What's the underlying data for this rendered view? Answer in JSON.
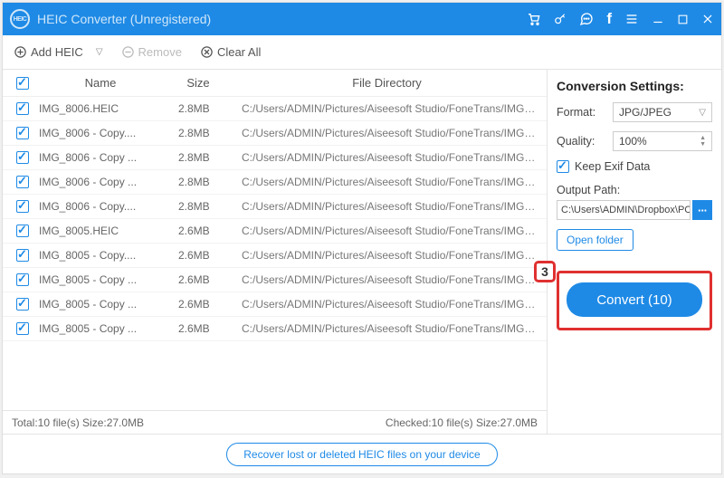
{
  "window": {
    "title": "HEIC Converter (Unregistered)"
  },
  "toolbar": {
    "addHeic": "Add HEIC",
    "remove": "Remove",
    "clearAll": "Clear All"
  },
  "table": {
    "headers": {
      "name": "Name",
      "size": "Size",
      "dir": "File Directory"
    },
    "rows": [
      {
        "name": "IMG_8006.HEIC",
        "size": "2.8MB",
        "dir": "C:/Users/ADMIN/Pictures/Aiseesoft Studio/FoneTrans/IMG_80..."
      },
      {
        "name": "IMG_8006 - Copy....",
        "size": "2.8MB",
        "dir": "C:/Users/ADMIN/Pictures/Aiseesoft Studio/FoneTrans/IMG_80..."
      },
      {
        "name": "IMG_8006 - Copy ...",
        "size": "2.8MB",
        "dir": "C:/Users/ADMIN/Pictures/Aiseesoft Studio/FoneTrans/IMG_80..."
      },
      {
        "name": "IMG_8006 - Copy ...",
        "size": "2.8MB",
        "dir": "C:/Users/ADMIN/Pictures/Aiseesoft Studio/FoneTrans/IMG_80..."
      },
      {
        "name": "IMG_8006 - Copy....",
        "size": "2.8MB",
        "dir": "C:/Users/ADMIN/Pictures/Aiseesoft Studio/FoneTrans/IMG_80..."
      },
      {
        "name": "IMG_8005.HEIC",
        "size": "2.6MB",
        "dir": "C:/Users/ADMIN/Pictures/Aiseesoft Studio/FoneTrans/IMG_80..."
      },
      {
        "name": "IMG_8005 - Copy....",
        "size": "2.6MB",
        "dir": "C:/Users/ADMIN/Pictures/Aiseesoft Studio/FoneTrans/IMG_80..."
      },
      {
        "name": "IMG_8005 - Copy ...",
        "size": "2.6MB",
        "dir": "C:/Users/ADMIN/Pictures/Aiseesoft Studio/FoneTrans/IMG_80..."
      },
      {
        "name": "IMG_8005 - Copy ...",
        "size": "2.6MB",
        "dir": "C:/Users/ADMIN/Pictures/Aiseesoft Studio/FoneTrans/IMG_80..."
      },
      {
        "name": "IMG_8005 - Copy ...",
        "size": "2.6MB",
        "dir": "C:/Users/ADMIN/Pictures/Aiseesoft Studio/FoneTrans/IMG_80..."
      }
    ]
  },
  "status": {
    "total": "Total:10 file(s) Size:27.0MB",
    "checked": "Checked:10 file(s) Size:27.0MB"
  },
  "bottom": {
    "recover": "Recover lost or deleted HEIC files on your device"
  },
  "settings": {
    "title": "Conversion Settings:",
    "formatLabel": "Format:",
    "formatValue": "JPG/JPEG",
    "qualityLabel": "Quality:",
    "qualityValue": "100%",
    "keepExif": "Keep Exif Data",
    "outputLabel": "Output Path:",
    "outputPath": "C:\\Users\\ADMIN\\Dropbox\\PC\\",
    "openFolder": "Open folder",
    "convert": "Convert (10)",
    "badge": "3"
  }
}
